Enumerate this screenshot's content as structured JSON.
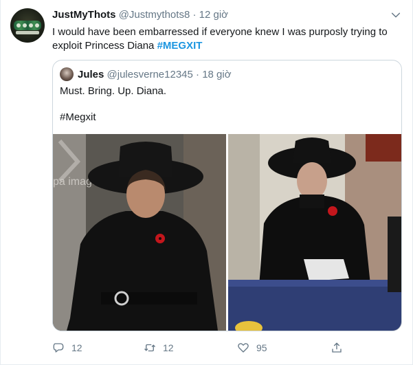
{
  "tweet": {
    "author": {
      "name": "JustMyThots",
      "handle": "@Justmythots8",
      "avatar_icon": "crown-avatar-icon"
    },
    "separator": "·",
    "time": "12 giờ",
    "text_before": "I would have been embarressed if everyone knew I was purposly trying to exploit Princess Diana ",
    "hashtag": "#MEGXIT",
    "menu_icon": "chevron-down-icon"
  },
  "quote": {
    "author": {
      "name": "Jules",
      "handle": "@julesverne12345",
      "avatar_icon": "user-avatar-icon"
    },
    "separator": "·",
    "time": "18 giờ",
    "line1": "Must. Bring. Up. Diana.",
    "line2": "#Megxit",
    "photos": [
      {
        "name": "photo-left",
        "watermark": "pa images"
      },
      {
        "name": "photo-right"
      }
    ]
  },
  "actions": {
    "reply": {
      "icon": "reply-icon",
      "count": "12"
    },
    "retweet": {
      "icon": "retweet-icon",
      "count": "12"
    },
    "like": {
      "icon": "heart-icon",
      "count": "95"
    },
    "share": {
      "icon": "share-icon"
    }
  },
  "colors": {
    "link": "#1b95e0",
    "secondary": "#657786",
    "border": "#ccd6dd"
  }
}
